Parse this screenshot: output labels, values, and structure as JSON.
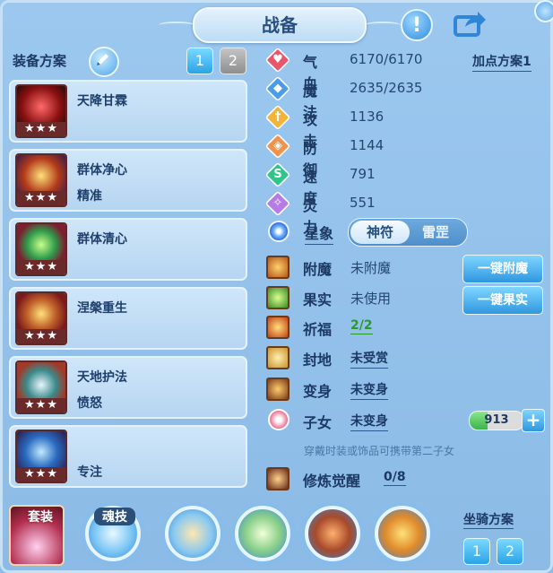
{
  "header": {
    "title": "战备",
    "alert_icon": "exclamation-icon",
    "share_icon": "share-icon"
  },
  "left": {
    "plan_label": "装备方案",
    "plan_buttons": [
      "1",
      "2"
    ],
    "equipment": [
      {
        "name": "天降甘霖",
        "sub": "",
        "stars": "★★★",
        "art": "red-sword"
      },
      {
        "name": "群体净心",
        "sub": "精准",
        "stars": "★★★",
        "art": "gold-helmet"
      },
      {
        "name": "群体清心",
        "sub": "",
        "stars": "★★★",
        "art": "green-necklace"
      },
      {
        "name": "涅槃重生",
        "sub": "",
        "stars": "★★★",
        "art": "gold-dragon-armor"
      },
      {
        "name": "天地护法",
        "sub": "愤怒",
        "stars": "★★★",
        "art": "jade-belt"
      },
      {
        "name": "",
        "sub": "专注",
        "stars": "★★★",
        "art": "blue-boots"
      }
    ]
  },
  "stats": {
    "add_point_plan": "加点方案1",
    "rows": [
      {
        "label": "气血",
        "value": "6170/6170",
        "color": "#e8566c",
        "glyph": "♥"
      },
      {
        "label": "魔法",
        "value": "2635/2635",
        "color": "#4a9be8",
        "glyph": "◆"
      },
      {
        "label": "攻击",
        "value": "1136",
        "color": "#f2b53a",
        "glyph": "†"
      },
      {
        "label": "防御",
        "value": "1144",
        "color": "#f0924a",
        "glyph": "◈"
      },
      {
        "label": "速度",
        "value": "791",
        "color": "#2fc58a",
        "glyph": "S"
      },
      {
        "label": "灵力",
        "value": "551",
        "color": "#b57ce6",
        "glyph": "✧"
      }
    ]
  },
  "star_sign": {
    "label": "星象",
    "toggle_on": "神符",
    "toggle_off": "雷罡"
  },
  "extras": {
    "enchant": {
      "label": "附魔",
      "value": "未附魔",
      "button": "一键附魔"
    },
    "fruit": {
      "label": "果实",
      "value": "未使用",
      "button": "一键果实"
    },
    "blessing": {
      "label": "祈福",
      "value": "2/2"
    },
    "fief": {
      "label": "封地",
      "value": "未受赏"
    },
    "transform": {
      "label": "变身",
      "value": "未变身"
    },
    "child": {
      "label": "子女",
      "value": "未变身",
      "bar_value": "913",
      "bar_fraction": 0.33
    },
    "hint": "穿戴时装或饰品可携带第二子女",
    "cultivation": {
      "label": "修炼觉醒",
      "value": "0/8"
    }
  },
  "bottom": {
    "set_label": "套装",
    "soul_label": "魂技",
    "mount_label": "坐骑方案",
    "mount_buttons": [
      "1",
      "2"
    ]
  }
}
